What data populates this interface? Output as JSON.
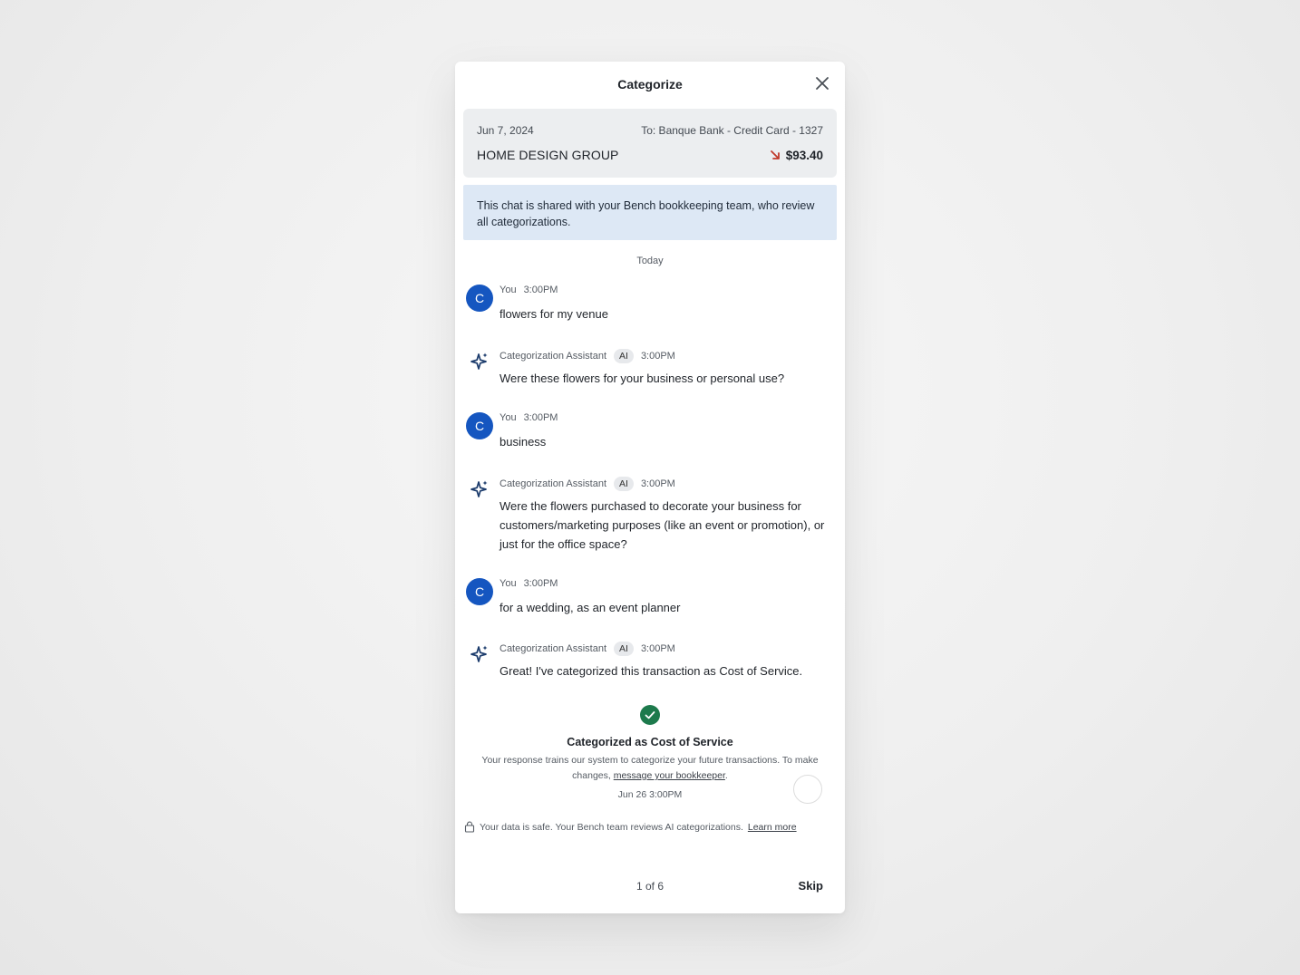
{
  "modal": {
    "title": "Categorize"
  },
  "transaction": {
    "date": "Jun 7, 2024",
    "account": "To: Banque Bank - Credit Card - 1327",
    "merchant": "HOME DESIGN GROUP",
    "amount": "$93.40",
    "direction_icon": "arrow-down-right-icon",
    "direction_color": "#c0392b"
  },
  "notice": {
    "text": "This chat is shared with your Bench bookkeeping team, who review all categorizations."
  },
  "chat": {
    "day_label": "Today",
    "messages": [
      {
        "sender": "You",
        "avatar": "C",
        "time": "3:00PM",
        "text": "flowers for my venue"
      },
      {
        "sender": "Categorization Assistant",
        "badge": "AI",
        "time": "3:00PM",
        "text": "Were these flowers for your business or personal use?"
      },
      {
        "sender": "You",
        "avatar": "C",
        "time": "3:00PM",
        "text": "business"
      },
      {
        "sender": "Categorization Assistant",
        "badge": "AI",
        "time": "3:00PM",
        "text": "Were the flowers purchased to decorate your business for customers/marketing purposes (like an event or promotion), or just for the office space?"
      },
      {
        "sender": "You",
        "avatar": "C",
        "time": "3:00PM",
        "text": "for a wedding, as an event planner"
      },
      {
        "sender": "Categorization Assistant",
        "badge": "AI",
        "time": "3:00PM",
        "text": "Great! I've categorized this transaction as Cost of Service."
      }
    ]
  },
  "confirmation": {
    "title": "Categorized as Cost of Service",
    "desc_prefix": "Your response trains our system to categorize your future transactions. To make changes, ",
    "link": "message your bookkeeper",
    "desc_suffix": ".",
    "timestamp": "Jun 26 3:00PM"
  },
  "safety": {
    "text": "Your data is safe. Your Bench team reviews AI categorizations.",
    "link": "Learn more"
  },
  "footer": {
    "progress": "1 of 6",
    "skip_label": "Skip"
  },
  "colors": {
    "avatar": "#1556c0",
    "notice_bg": "#dde8f5",
    "success": "#1d7a4c",
    "assistant_icon": "#1a3a6b"
  }
}
